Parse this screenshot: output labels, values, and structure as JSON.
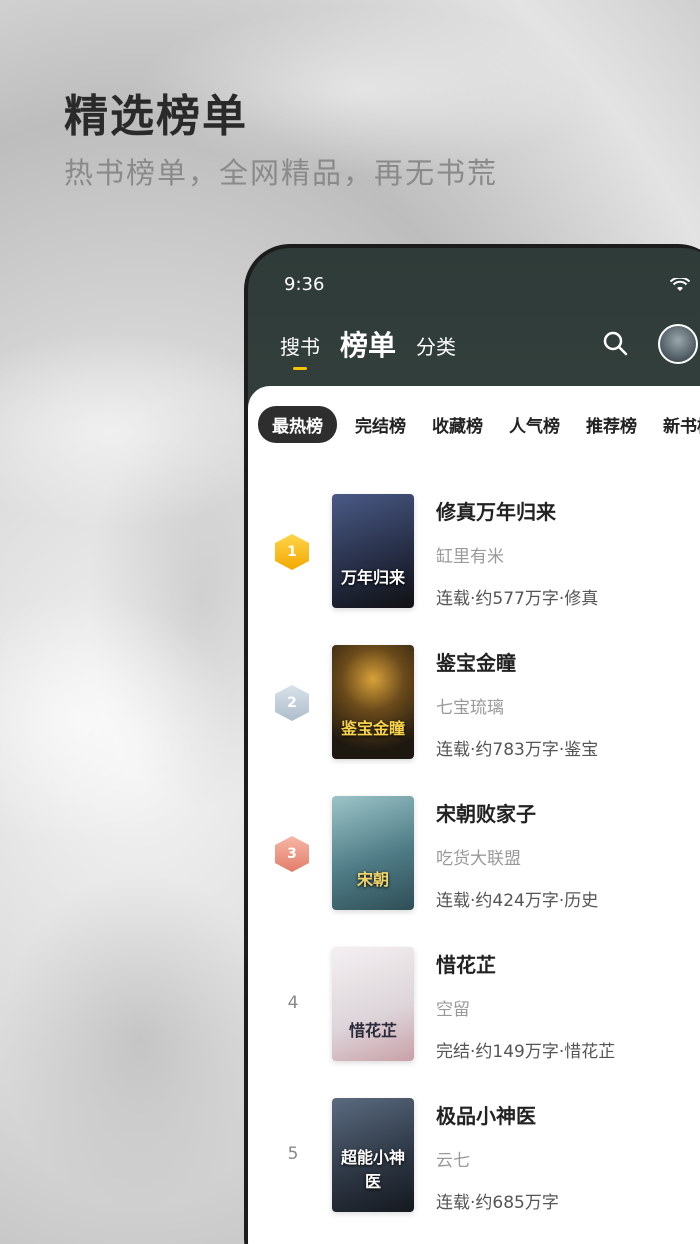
{
  "promo": {
    "headline": "精选榜单",
    "subline": "热书榜单，全网精品，再无书荒"
  },
  "status_bar": {
    "time": "9:36"
  },
  "top_nav": {
    "tabs": [
      {
        "label": "搜书"
      },
      {
        "label": "榜单"
      },
      {
        "label": "分类"
      }
    ],
    "active_tab": "榜单",
    "search_icon": "search-icon",
    "avatar_icon": "avatar"
  },
  "rank_tabs": [
    "最热榜",
    "完结榜",
    "收藏榜",
    "人气榜",
    "推荐榜",
    "新书榜"
  ],
  "books": [
    {
      "rank": "1",
      "title": "修真万年归来",
      "author": "缸里有米",
      "meta": "连载·约577万字·修真",
      "cover_text": "万年归来",
      "cover_color": "#2a3450"
    },
    {
      "rank": "2",
      "title": "鉴宝金瞳",
      "author": "七宝琉璃",
      "meta": "连载·约783万字·鉴宝",
      "cover_text": "鉴宝金瞳",
      "cover_color": "#3b3320"
    },
    {
      "rank": "3",
      "title": "宋朝败家子",
      "author": "吃货大联盟",
      "meta": "连载·约424万字·历史",
      "cover_text": "宋朝",
      "cover_color": "#5f8e9a"
    },
    {
      "rank": "4",
      "title": "惜花芷",
      "author": "空留",
      "meta": "完结·约149万字·惜花芷",
      "cover_text": "惜花芷",
      "cover_color": "#e8e4e6"
    },
    {
      "rank": "5",
      "title": "极品小神医",
      "author": "云七",
      "meta": "连载·约685万字",
      "cover_text": "超能小神医",
      "cover_color": "#2e3a48"
    }
  ],
  "colors": {
    "accent": "#f5c400",
    "chip_active_bg": "#2e2e2e"
  }
}
